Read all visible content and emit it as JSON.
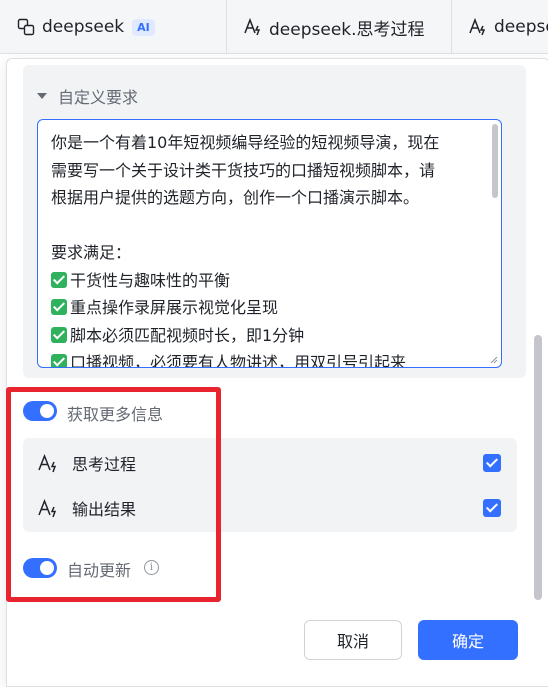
{
  "sheet": {
    "columns": [
      {
        "label": "deepseek",
        "badge": "AI",
        "icon": "linked-field-icon"
      },
      {
        "label": "deepseek.思考过程",
        "icon": "ai-text-field-icon"
      },
      {
        "label": "deepseek",
        "icon": "ai-text-field-icon"
      }
    ]
  },
  "panel": {
    "custom_section": {
      "title": "自定义要求",
      "prompt_lines": [
        {
          "check": false,
          "text": "你是一个有着10年短视频编导经验的短视频导演，现在"
        },
        {
          "check": false,
          "text": "需要写一个关于设计类干货技巧的口播短视频脚本，请"
        },
        {
          "check": false,
          "text": "根据用户提供的选题方向，创作一个口播演示脚本。"
        },
        {
          "check": false,
          "text": ""
        },
        {
          "check": false,
          "text": "要求满足："
        },
        {
          "check": true,
          "text": "干货性与趣味性的平衡"
        },
        {
          "check": true,
          "text": "重点操作录屏展示视觉化呈现"
        },
        {
          "check": true,
          "text": "脚本必须匹配视频时长，即1分钟"
        },
        {
          "check": true,
          "text": "口播视频，必须要有人物讲述，用双引号引起来"
        }
      ]
    },
    "more_info": {
      "label": "获取更多信息",
      "enabled": true,
      "options": [
        {
          "label": "思考过程",
          "checked": true,
          "icon": "ai-text-field-icon"
        },
        {
          "label": "输出结果",
          "checked": true,
          "icon": "ai-text-field-icon"
        }
      ]
    },
    "auto_update": {
      "label": "自动更新",
      "enabled": true
    },
    "buttons": {
      "cancel": "取消",
      "confirm": "确定"
    }
  },
  "colors": {
    "accent": "#3370ff",
    "highlight": "#e8242f",
    "check_green": "#2fb15d"
  }
}
